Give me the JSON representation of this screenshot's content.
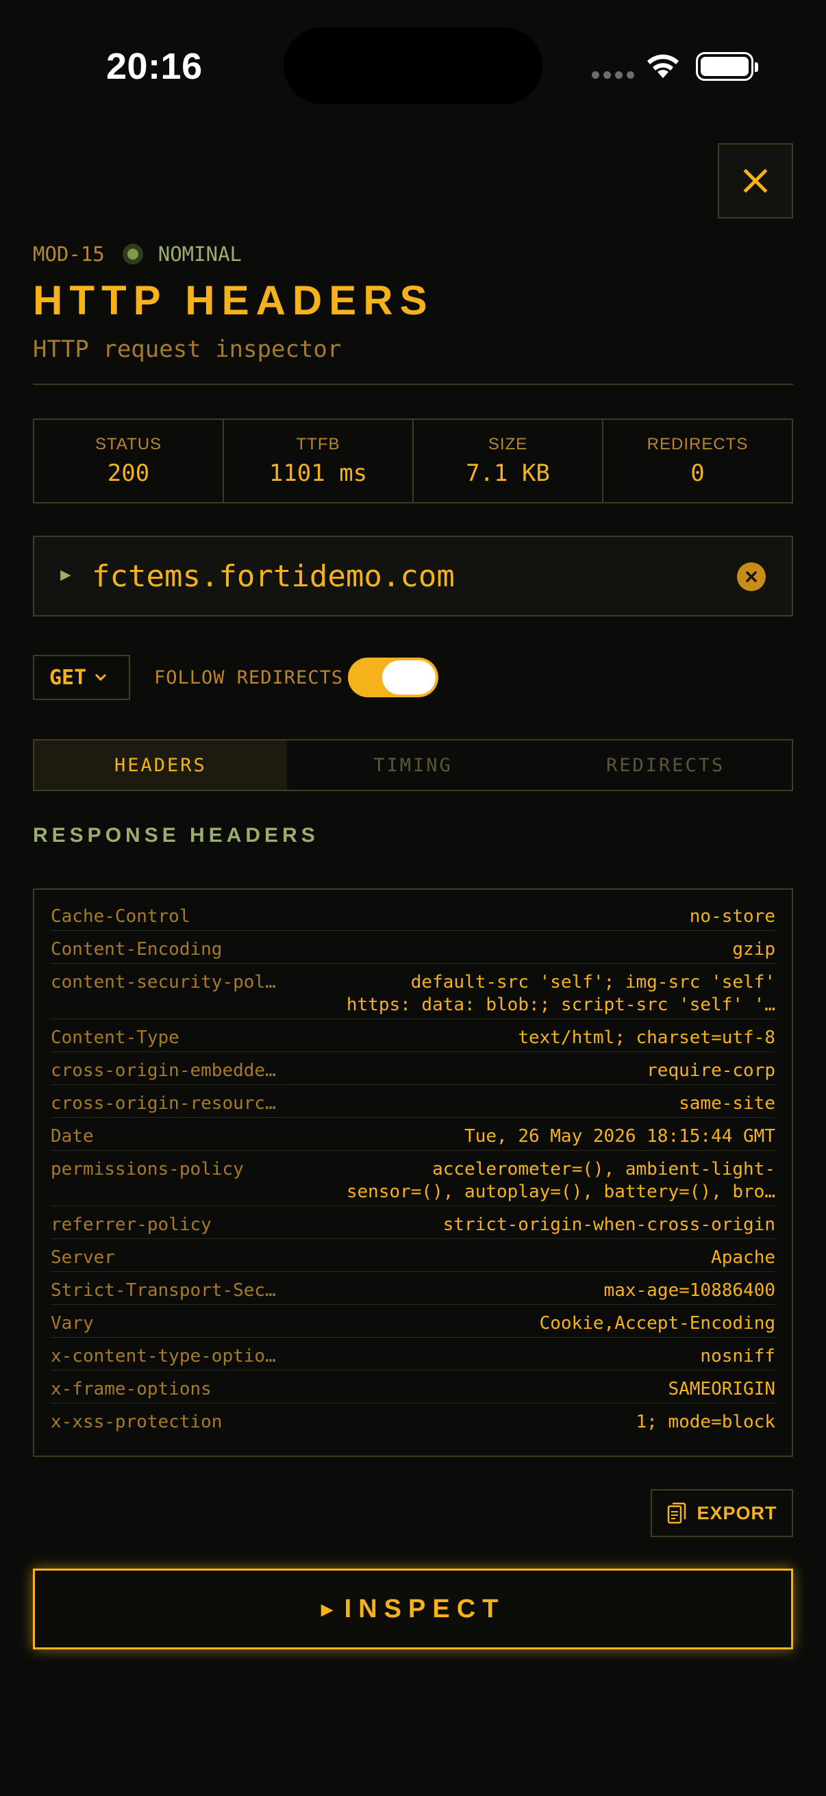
{
  "status_bar": {
    "time": "20:16"
  },
  "module": {
    "id": "MOD-15",
    "state": "NOMINAL"
  },
  "header": {
    "title": "HTTP HEADERS",
    "subtitle": "HTTP request inspector"
  },
  "stats": [
    {
      "label": "STATUS",
      "value": "200"
    },
    {
      "label": "TTFB",
      "value": "1101 ms"
    },
    {
      "label": "SIZE",
      "value": "7.1 KB"
    },
    {
      "label": "REDIRECTS",
      "value": "0"
    }
  ],
  "url_input": {
    "value": "fctems.fortidemo.com"
  },
  "controls": {
    "method": "GET",
    "follow_redirects_label": "FOLLOW REDIRECTS",
    "follow_redirects": true
  },
  "tabs": [
    {
      "label": "HEADERS",
      "active": true
    },
    {
      "label": "TIMING",
      "active": false
    },
    {
      "label": "REDIRECTS",
      "active": false
    }
  ],
  "section_title": "RESPONSE HEADERS",
  "headers": [
    {
      "key": "Cache-Control",
      "value": [
        "no-store"
      ]
    },
    {
      "key": "Content-Encoding",
      "value": [
        "gzip"
      ]
    },
    {
      "key": "content-security-pol…",
      "value": [
        "default-src 'self'; img-src 'self'",
        "https: data: blob:; script-src 'self' '…"
      ]
    },
    {
      "key": "Content-Type",
      "value": [
        "text/html; charset=utf-8"
      ]
    },
    {
      "key": "cross-origin-embedde…",
      "value": [
        "require-corp"
      ]
    },
    {
      "key": "cross-origin-resourc…",
      "value": [
        "same-site"
      ]
    },
    {
      "key": "Date",
      "value": [
        "Tue, 26 May 2026 18:15:44 GMT"
      ]
    },
    {
      "key": "permissions-policy",
      "value": [
        "accelerometer=(), ambient-light-",
        "sensor=(), autoplay=(), battery=(), bro…"
      ]
    },
    {
      "key": "referrer-policy",
      "value": [
        "strict-origin-when-cross-origin"
      ]
    },
    {
      "key": "Server",
      "value": [
        "Apache"
      ]
    },
    {
      "key": "Strict-Transport-Sec…",
      "value": [
        "max-age=10886400"
      ]
    },
    {
      "key": "Vary",
      "value": [
        "Cookie,Accept-Encoding"
      ]
    },
    {
      "key": "x-content-type-optio…",
      "value": [
        "nosniff"
      ]
    },
    {
      "key": "x-frame-options",
      "value": [
        "SAMEORIGIN"
      ]
    },
    {
      "key": "x-xss-protection",
      "value": [
        "1; mode=block"
      ]
    }
  ],
  "actions": {
    "export_label": "EXPORT",
    "inspect_label": "INSPECT"
  },
  "icons": {
    "close": "close-icon",
    "clear": "clear-circle-icon",
    "chevron": "chevron-down-icon",
    "export": "clipboard-icon",
    "play": "play-icon"
  },
  "colors": {
    "background": "#0b0c0a",
    "accent": "#f5b21b",
    "muted": "#b9862c",
    "green": "#9bae6e",
    "border": "#3e3c22"
  }
}
